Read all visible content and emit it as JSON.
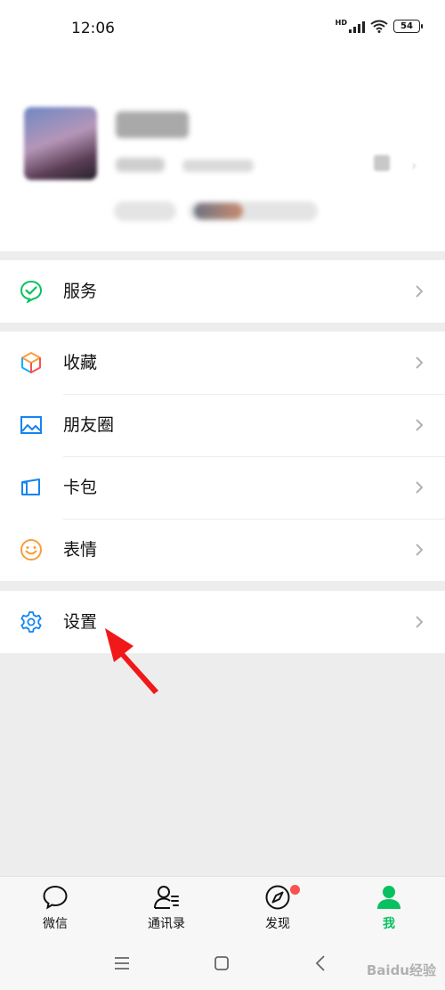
{
  "status_bar": {
    "time": "12:06",
    "network": "HD",
    "battery": "54"
  },
  "menu": {
    "services": {
      "label": "服务"
    },
    "favorites": {
      "label": "收藏"
    },
    "moments": {
      "label": "朋友圈"
    },
    "cards": {
      "label": "卡包"
    },
    "stickers": {
      "label": "表情"
    },
    "settings": {
      "label": "设置"
    }
  },
  "tabs": [
    {
      "label": "微信",
      "icon": "chat-bubble-icon"
    },
    {
      "label": "通讯录",
      "icon": "contacts-icon"
    },
    {
      "label": "发现",
      "icon": "compass-icon"
    },
    {
      "label": "我",
      "icon": "person-icon"
    }
  ],
  "watermark": "Baidu经验",
  "colors": {
    "accent": "#07c160",
    "badge": "#fa5151",
    "arrow": "#f01818"
  }
}
